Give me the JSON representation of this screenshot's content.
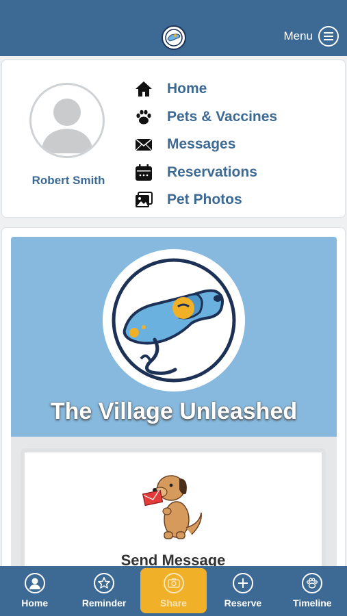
{
  "header": {
    "menu_label": "Menu"
  },
  "profile": {
    "name": "Robert Smith"
  },
  "nav": {
    "items": [
      {
        "label": "Home",
        "icon": "home-icon"
      },
      {
        "label": "Pets & Vaccines",
        "icon": "paw-icon"
      },
      {
        "label": "Messages",
        "icon": "envelope-icon"
      },
      {
        "label": "Reservations",
        "icon": "calendar-icon"
      },
      {
        "label": "Pet Photos",
        "icon": "photos-icon"
      }
    ]
  },
  "hero": {
    "title": "The Village Unleashed"
  },
  "actions": {
    "send_message": "Send Message"
  },
  "tabbar": {
    "tabs": [
      {
        "label": "Home",
        "icon": "user-icon",
        "active": false
      },
      {
        "label": "Reminder",
        "icon": "star-icon",
        "active": false
      },
      {
        "label": "Share",
        "icon": "camera-icon",
        "active": true
      },
      {
        "label": "Reserve",
        "icon": "plus-icon",
        "active": false
      },
      {
        "label": "Timeline",
        "icon": "paw-icon",
        "active": false
      }
    ]
  },
  "colors": {
    "primary": "#3d6a94",
    "hero_bg": "#86b9dd",
    "accent": "#f0b028"
  }
}
